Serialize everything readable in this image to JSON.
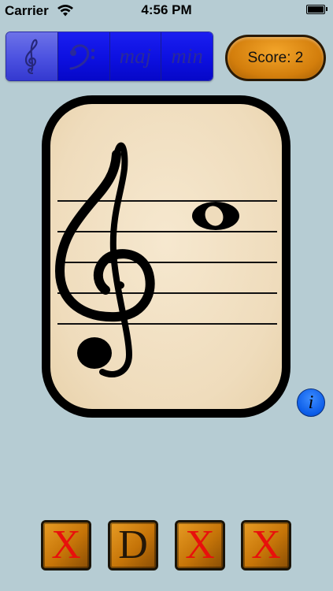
{
  "status_bar": {
    "carrier": "Carrier",
    "time": "4:56 PM",
    "icons": [
      "wifi-icon",
      "battery-icon"
    ]
  },
  "clef_selector": {
    "segments": [
      {
        "label": "treble-clef-icon",
        "selected": true
      },
      {
        "label": "bass-clef-icon",
        "selected": false
      },
      {
        "label": "maj",
        "selected": false
      },
      {
        "label": "min",
        "selected": false
      }
    ]
  },
  "score": {
    "text": "Score: 2"
  },
  "card": {
    "clef": "treble",
    "note_type": "whole-note",
    "staff_lines": 5
  },
  "info_button": {
    "label": "i"
  },
  "answers": [
    {
      "label": "X",
      "state": "wrong"
    },
    {
      "label": "D",
      "state": "available"
    },
    {
      "label": "X",
      "state": "wrong"
    },
    {
      "label": "X",
      "state": "wrong"
    }
  ],
  "colors": {
    "background": "#b6ccd3",
    "segment_blue": "#0d10e0",
    "score_orange": "#d37e0c",
    "card_paper": "#efdcbc",
    "wrong_red": "#e8100c",
    "info_blue": "#0b5ce8"
  }
}
